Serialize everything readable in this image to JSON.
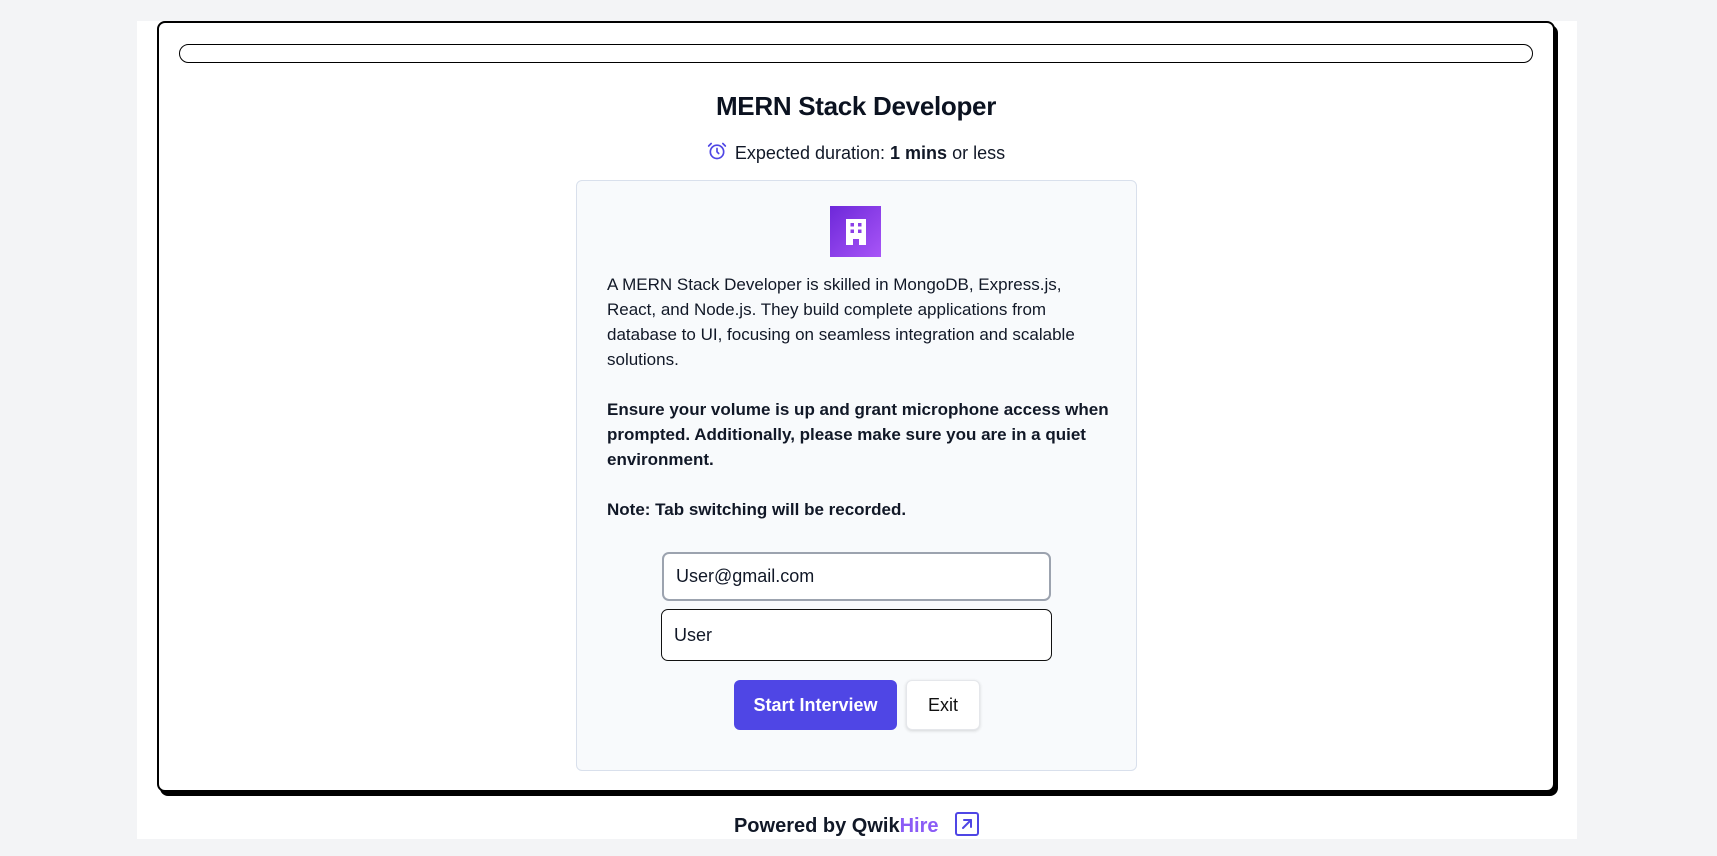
{
  "progress": {
    "percent": 0
  },
  "job": {
    "title": "MERN Stack Developer",
    "duration_prefix": "Expected duration:",
    "duration_value": "1 mins",
    "duration_suffix": "or less",
    "description": "A MERN Stack Developer is skilled in MongoDB, Express.js, React, and Node.js. They build complete applications from database to UI, focusing on seamless integration and scalable solutions.",
    "instructions": "Ensure your volume is up and grant microphone access when prompted. Additionally, please make sure you are in a quiet environment.",
    "note": "Note: Tab switching will be recorded."
  },
  "form": {
    "email_value": "User@gmail.com",
    "name_value": "User"
  },
  "actions": {
    "start_label": "Start Interview",
    "exit_label": "Exit"
  },
  "footer": {
    "powered_prefix": "Powered by",
    "brand_first": "Qwik",
    "brand_second": "Hire"
  },
  "icons": {
    "duration": "alarm-clock-icon",
    "logo": "building-icon",
    "footer_link": "external-link-icon"
  },
  "colors": {
    "accent": "#4f46e5",
    "brand_purple": "#8b5cf6",
    "logo_gradient_start": "#6d28d9",
    "logo_gradient_end": "#a855f7"
  }
}
